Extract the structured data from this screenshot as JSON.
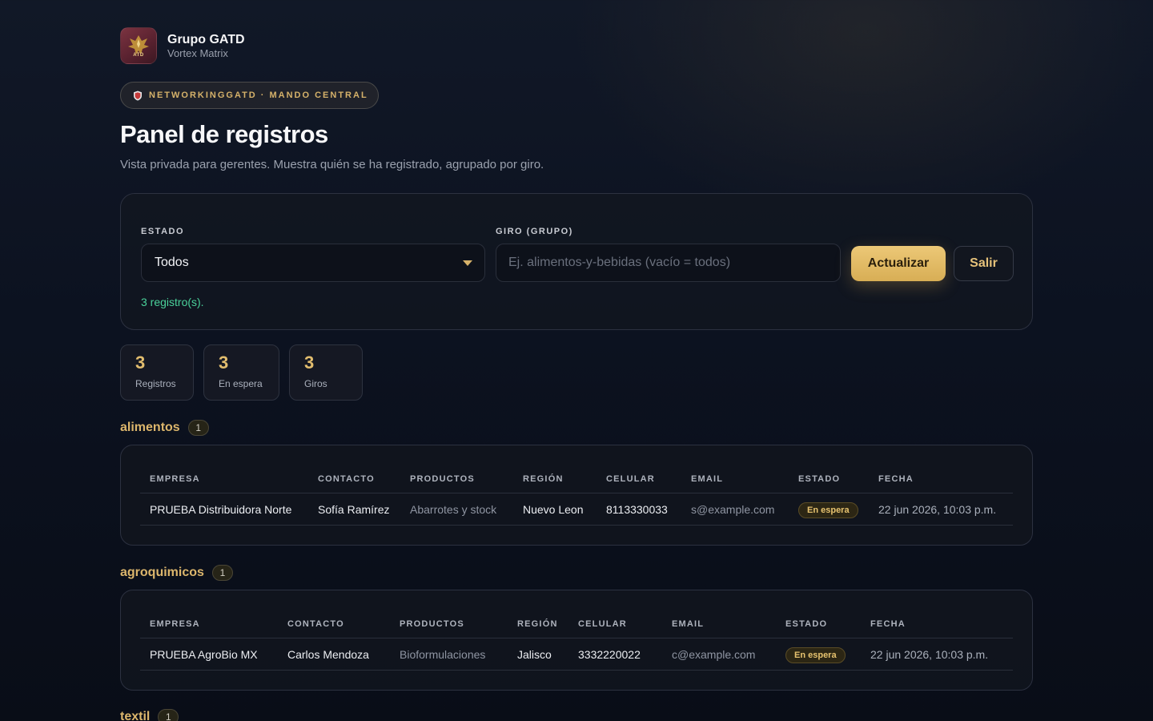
{
  "brand": {
    "name": "Grupo GATD",
    "subtitle": "Vortex Matrix",
    "logo_text": "ATD"
  },
  "pill": {
    "label": "NETWORKINGGATD · MANDO CENTRAL",
    "icon": "shield-icon"
  },
  "page": {
    "title": "Panel de registros",
    "subtitle": "Vista privada para gerentes. Muestra quién se ha registrado, agrupado por giro."
  },
  "filters": {
    "estado_label": "ESTADO",
    "estado_value": "Todos",
    "giro_label": "GIRO (GRUPO)",
    "giro_placeholder": "Ej. alimentos-y-bebidas (vacío = todos)",
    "giro_value": "",
    "refresh_label": "Actualizar",
    "logout_label": "Salir",
    "result_message": "3 registro(s)."
  },
  "stats": [
    {
      "value": "3",
      "label": "Registros"
    },
    {
      "value": "3",
      "label": "En espera"
    },
    {
      "value": "3",
      "label": "Giros"
    }
  ],
  "columns": [
    "EMPRESA",
    "CONTACTO",
    "PRODUCTOS",
    "REGIÓN",
    "CELULAR",
    "EMAIL",
    "ESTADO",
    "FECHA"
  ],
  "groups": [
    {
      "name": "alimentos",
      "count": "1",
      "rows": [
        {
          "empresa": "PRUEBA Distribuidora Norte",
          "contacto": "Sofía Ramírez",
          "productos": "Abarrotes y stock",
          "region": "Nuevo Leon",
          "celular": "8113330033",
          "email": "s@example.com",
          "estado": "En espera",
          "fecha": "22 jun 2026, 10:03 p.m."
        }
      ]
    },
    {
      "name": "agroquimicos",
      "count": "1",
      "rows": [
        {
          "empresa": "PRUEBA AgroBio MX",
          "contacto": "Carlos Mendoza",
          "productos": "Bioformulaciones",
          "region": "Jalisco",
          "celular": "3332220022",
          "email": "c@example.com",
          "estado": "En espera",
          "fecha": "22 jun 2026, 10:03 p.m."
        }
      ]
    },
    {
      "name": "textil",
      "count": "1",
      "rows": []
    }
  ],
  "colors": {
    "accent_gold": "#d6b26a",
    "success_green": "#4ad19a",
    "background": "#0c1220"
  }
}
